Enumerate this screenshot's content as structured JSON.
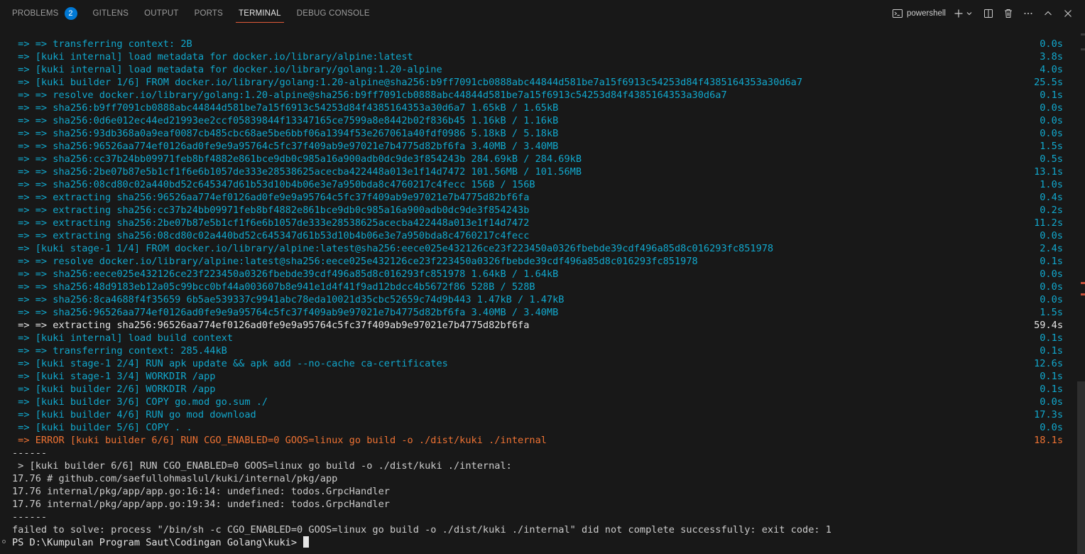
{
  "tabs": [
    {
      "label": "PROBLEMS",
      "badge": "2"
    },
    {
      "label": "GITLENS"
    },
    {
      "label": "OUTPUT"
    },
    {
      "label": "PORTS"
    },
    {
      "label": "TERMINAL",
      "active": true
    },
    {
      "label": "DEBUG CONSOLE"
    }
  ],
  "toolbar": {
    "shell_label": "powershell",
    "icons": [
      "terminal-icon",
      "plus-icon",
      "chevron-down-icon",
      "split-icon",
      "trash-icon",
      "ellipsis-icon",
      "chevron-up-icon",
      "close-icon"
    ]
  },
  "colors": {
    "cyan": "#11a8cd",
    "error": "#ee7233",
    "accent_tab": "#e25a39",
    "badge": "#0078d4"
  },
  "terminal": {
    "lines": [
      {
        "text": " => => transferring context: 2B",
        "dur": "0.0s",
        "color": "cyan"
      },
      {
        "text": " => [kuki internal] load metadata for docker.io/library/alpine:latest",
        "dur": "3.8s",
        "color": "cyan"
      },
      {
        "text": " => [kuki internal] load metadata for docker.io/library/golang:1.20-alpine",
        "dur": "4.0s",
        "color": "cyan"
      },
      {
        "text": " => [kuki builder 1/6] FROM docker.io/library/golang:1.20-alpine@sha256:b9ff7091cb0888abc44844d581be7a15f6913c54253d84f4385164353a30d6a7",
        "dur": "25.5s",
        "color": "cyan"
      },
      {
        "text": " => => resolve docker.io/library/golang:1.20-alpine@sha256:b9ff7091cb0888abc44844d581be7a15f6913c54253d84f4385164353a30d6a7",
        "dur": "0.1s",
        "color": "cyan"
      },
      {
        "text": " => => sha256:b9ff7091cb0888abc44844d581be7a15f6913c54253d84f4385164353a30d6a7 1.65kB / 1.65kB",
        "dur": "0.0s",
        "color": "cyan"
      },
      {
        "text": " => => sha256:0d6e012ec44ed21993ee2ccf05839844f13347165ce7599a8e8442b02f836b45 1.16kB / 1.16kB",
        "dur": "0.0s",
        "color": "cyan"
      },
      {
        "text": " => => sha256:93db368a0a9eaf0087cb485cbc68ae5be6bbf06a1394f53e267061a40fdf0986 5.18kB / 5.18kB",
        "dur": "0.0s",
        "color": "cyan"
      },
      {
        "text": " => => sha256:96526aa774ef0126ad0fe9e9a95764c5fc37f409ab9e97021e7b4775d82bf6fa 3.40MB / 3.40MB",
        "dur": "1.5s",
        "color": "cyan"
      },
      {
        "text": " => => sha256:cc37b24bb09971feb8bf4882e861bce9db0c985a16a900adb0dc9de3f854243b 284.69kB / 284.69kB",
        "dur": "0.5s",
        "color": "cyan"
      },
      {
        "text": " => => sha256:2be07b87e5b1cf1f6e6b1057de333e28538625acecba422448a013e1f14d7472 101.56MB / 101.56MB",
        "dur": "13.1s",
        "color": "cyan"
      },
      {
        "text": " => => sha256:08cd80c02a440bd52c645347d61b53d10b4b06e3e7a950bda8c4760217c4fecc 156B / 156B",
        "dur": "1.0s",
        "color": "cyan"
      },
      {
        "text": " => => extracting sha256:96526aa774ef0126ad0fe9e9a95764c5fc37f409ab9e97021e7b4775d82bf6fa",
        "dur": "0.4s",
        "color": "cyan"
      },
      {
        "text": " => => extracting sha256:cc37b24bb09971feb8bf4882e861bce9db0c985a16a900adb0dc9de3f854243b",
        "dur": "0.2s",
        "color": "cyan"
      },
      {
        "text": " => => extracting sha256:2be07b87e5b1cf1f6e6b1057de333e28538625acecba422448a013e1f14d7472",
        "dur": "11.2s",
        "color": "cyan"
      },
      {
        "text": " => => extracting sha256:08cd80c02a440bd52c645347d61b53d10b4b06e3e7a950bda8c4760217c4fecc",
        "dur": "0.0s",
        "color": "cyan"
      },
      {
        "text": " => [kuki stage-1 1/4] FROM docker.io/library/alpine:latest@sha256:eece025e432126ce23f223450a0326fbebde39cdf496a85d8c016293fc851978",
        "dur": "2.4s",
        "color": "cyan"
      },
      {
        "text": " => => resolve docker.io/library/alpine:latest@sha256:eece025e432126ce23f223450a0326fbebde39cdf496a85d8c016293fc851978",
        "dur": "0.1s",
        "color": "cyan"
      },
      {
        "text": " => => sha256:eece025e432126ce23f223450a0326fbebde39cdf496a85d8c016293fc851978 1.64kB / 1.64kB",
        "dur": "0.0s",
        "color": "cyan"
      },
      {
        "text": " => => sha256:48d9183eb12a05c99bcc0bf44a003607b8e941e1d4f41f9ad12bdcc4b5672f86 528B / 528B",
        "dur": "0.0s",
        "color": "cyan"
      },
      {
        "text": " => => sha256:8ca4688f4f35659 6b5ae539337c9941abc78eda10021d35cbc52659c74d9b443 1.47kB / 1.47kB",
        "dur": "0.0s",
        "color": "cyan"
      },
      {
        "text": " => => sha256:96526aa774ef0126ad0fe9e9a95764c5fc37f409ab9e97021e7b4775d82bf6fa 3.40MB / 3.40MB",
        "dur": "1.5s",
        "color": "cyan"
      },
      {
        "text": " => => extracting sha256:96526aa774ef0126ad0fe9e9a95764c5fc37f409ab9e97021e7b4775d82bf6fa",
        "dur": "59.4s",
        "color": "white"
      },
      {
        "text": " => [kuki internal] load build context",
        "dur": "0.1s",
        "color": "cyan"
      },
      {
        "text": " => => transferring context: 285.44kB",
        "dur": "0.1s",
        "color": "cyan"
      },
      {
        "text": " => [kuki stage-1 2/4] RUN apk update && apk add --no-cache ca-certificates",
        "dur": "12.6s",
        "color": "cyan"
      },
      {
        "text": " => [kuki stage-1 3/4] WORKDIR /app",
        "dur": "0.1s",
        "color": "cyan"
      },
      {
        "text": " => [kuki builder 2/6] WORKDIR /app",
        "dur": "0.1s",
        "color": "cyan"
      },
      {
        "text": " => [kuki builder 3/6] COPY go.mod go.sum ./",
        "dur": "0.0s",
        "color": "cyan"
      },
      {
        "text": " => [kuki builder 4/6] RUN go mod download",
        "dur": "17.3s",
        "color": "cyan"
      },
      {
        "text": " => [kuki builder 5/6] COPY . .",
        "dur": "0.0s",
        "color": "cyan"
      },
      {
        "text": " => ERROR [kuki builder 6/6] RUN CGO_ENABLED=0 GOOS=linux go build -o ./dist/kuki ./internal",
        "dur": "18.1s",
        "color": "orange"
      },
      {
        "text": "------",
        "dur": "",
        "color": "plain"
      },
      {
        "text": " > [kuki builder 6/6] RUN CGO_ENABLED=0 GOOS=linux go build -o ./dist/kuki ./internal:",
        "dur": "",
        "color": "plain"
      },
      {
        "text": "17.76 # github.com/saefullohmaslul/kuki/internal/pkg/app",
        "dur": "",
        "color": "plain"
      },
      {
        "text": "17.76 internal/pkg/app/app.go:16:14: undefined: todos.GrpcHandler",
        "dur": "",
        "color": "plain"
      },
      {
        "text": "17.76 internal/pkg/app/app.go:19:34: undefined: todos.GrpcHandler",
        "dur": "",
        "color": "plain"
      },
      {
        "text": "------",
        "dur": "",
        "color": "plain"
      },
      {
        "text": "failed to solve: process \"/bin/sh -c CGO_ENABLED=0 GOOS=linux go build -o ./dist/kuki ./internal\" did not complete successfully: exit code: 1",
        "dur": "",
        "color": "plain"
      }
    ],
    "prompt": "PS D:\\Kumpulan Program Saut\\Codingan Golang\\kuki> "
  }
}
